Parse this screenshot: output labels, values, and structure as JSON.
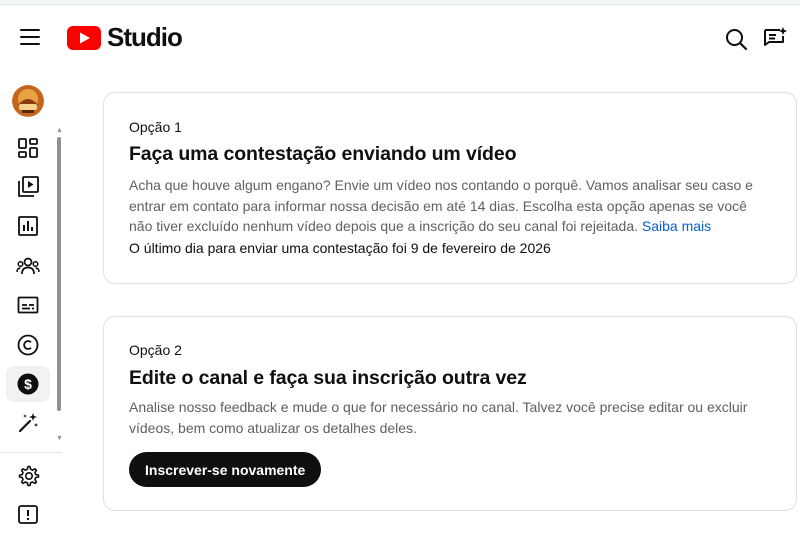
{
  "header": {
    "logo_text": "Studio",
    "brand_color": "#ff0000",
    "icons": [
      "menu-icon",
      "youtube-logo-icon",
      "search-icon",
      "feedback-icon"
    ]
  },
  "sidebar": {
    "items": [
      {
        "name": "dashboard",
        "icon": "dashboard-icon"
      },
      {
        "name": "content",
        "icon": "content-icon"
      },
      {
        "name": "analytics",
        "icon": "analytics-icon"
      },
      {
        "name": "community",
        "icon": "community-icon"
      },
      {
        "name": "subtitles",
        "icon": "subtitles-icon"
      },
      {
        "name": "copyright",
        "icon": "copyright-icon"
      },
      {
        "name": "earn",
        "icon": "dollar-icon",
        "active": true
      },
      {
        "name": "customization",
        "icon": "magic-wand-icon"
      },
      {
        "name": "settings",
        "icon": "gear-icon"
      },
      {
        "name": "send-feedback",
        "icon": "alert-icon"
      }
    ]
  },
  "option1": {
    "label": "Opção 1",
    "title": "Faça uma contestação enviando um vídeo",
    "description": "Acha que houve algum engano? Envie um vídeo nos contando o porquê. Vamos analisar seu caso e entrar em contato para informar nossa decisão em até 14 dias. Escolha esta opção apenas se você não tiver excluído nenhum vídeo depois que a inscrição do seu canal foi rejeitada.",
    "link_text": "Saiba mais",
    "note": "O último dia para enviar uma contestação foi 9 de fevereiro de 2026"
  },
  "option2": {
    "label": "Opção 2",
    "title": "Edite o canal e faça sua inscrição outra vez",
    "description": "Analise nosso feedback e mude o que for necessário no canal. Talvez você precise editar ou excluir vídeos, bem como atualizar os detalhes deles.",
    "button_label": "Inscrever-se novamente"
  },
  "colors": {
    "link": "#065fd4",
    "primary_button": "#0f0f0f",
    "secondary_text": "#606060"
  }
}
